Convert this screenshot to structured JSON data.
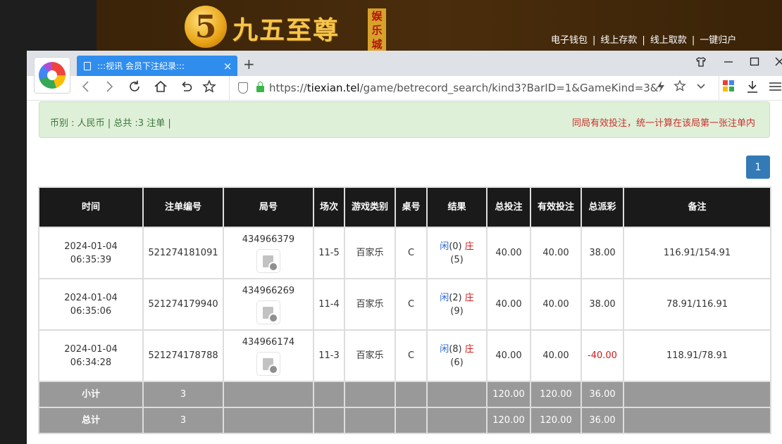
{
  "site": {
    "logo_char": "5",
    "title": "九五至尊",
    "badge": "娱乐城",
    "nav": [
      "电子钱包",
      "线上存款",
      "线上取款",
      "一键归户"
    ],
    "nav_sep": "|"
  },
  "browser": {
    "tab_title": ":::视讯 会员下注纪录:::",
    "tab_close": "×",
    "new_tab": "+",
    "url_prefix": "https://",
    "url_host": "tiexian.tel",
    "url_path": "/game/betrecord_search/kind3?BarID=1&GameKind=3&"
  },
  "summary": {
    "left": "币别 : 人民币 | 总共 :3 注单 |",
    "right": "同局有效投注，统一计算在该局第一张注单内"
  },
  "pagination": {
    "current": "1"
  },
  "table": {
    "headers": [
      "时间",
      "注单编号",
      "局号",
      "场次",
      "游戏类别",
      "桌号",
      "结果",
      "总投注",
      "有效投注",
      "总派彩",
      "备注"
    ],
    "rows": [
      {
        "date": "2024-01-04",
        "time": "06:35:39",
        "bet_id": "521274181091",
        "round": "434966379",
        "session": "11-5",
        "game": "百家乐",
        "table": "C",
        "player_label": "闲",
        "player_val": "(0)",
        "banker_label": "庄",
        "banker_val": "(5)",
        "total_bet": "40.00",
        "valid_bet": "40.00",
        "payout": "38.00",
        "payout_color": "normal",
        "remark": "116.91/154.91"
      },
      {
        "date": "2024-01-04",
        "time": "06:35:06",
        "bet_id": "521274179940",
        "round": "434966269",
        "session": "11-4",
        "game": "百家乐",
        "table": "C",
        "player_label": "闲",
        "player_val": "(2)",
        "banker_label": "庄",
        "banker_val": "(9)",
        "total_bet": "40.00",
        "valid_bet": "40.00",
        "payout": "38.00",
        "payout_color": "normal",
        "remark": "78.91/116.91"
      },
      {
        "date": "2024-01-04",
        "time": "06:34:28",
        "bet_id": "521274178788",
        "round": "434966174",
        "session": "11-3",
        "game": "百家乐",
        "table": "C",
        "player_label": "闲",
        "player_val": "(8)",
        "banker_label": "庄",
        "banker_val": "(6)",
        "total_bet": "40.00",
        "valid_bet": "40.00",
        "payout": "-40.00",
        "payout_color": "red",
        "remark": "118.91/78.91"
      }
    ],
    "subtotal": {
      "label": "小计",
      "count": "3",
      "total_bet": "120.00",
      "valid_bet": "120.00",
      "payout": "36.00"
    },
    "total": {
      "label": "总计",
      "count": "3",
      "total_bet": "120.00",
      "valid_bet": "120.00",
      "payout": "36.00"
    }
  },
  "colors": {
    "header_bg": "#1a1a1a",
    "sum_bg": "#999999",
    "alert_bg": "#dff0d8",
    "accent": "#337ab7",
    "negative": "#d01a1a",
    "tab_bg": "#2f8dee"
  },
  "icons": [
    "app-logo-icon",
    "doc-icon",
    "close-icon",
    "back-icon",
    "forward-icon",
    "reload-icon",
    "home-icon",
    "undo-icon",
    "star-icon",
    "shield-icon",
    "lock-icon",
    "bolt-icon",
    "chevron-down-icon",
    "apps-icon",
    "download-icon",
    "menu-icon",
    "shirt-icon",
    "minimize-icon",
    "maximize-icon",
    "window-close-icon",
    "video-replay-icon"
  ]
}
